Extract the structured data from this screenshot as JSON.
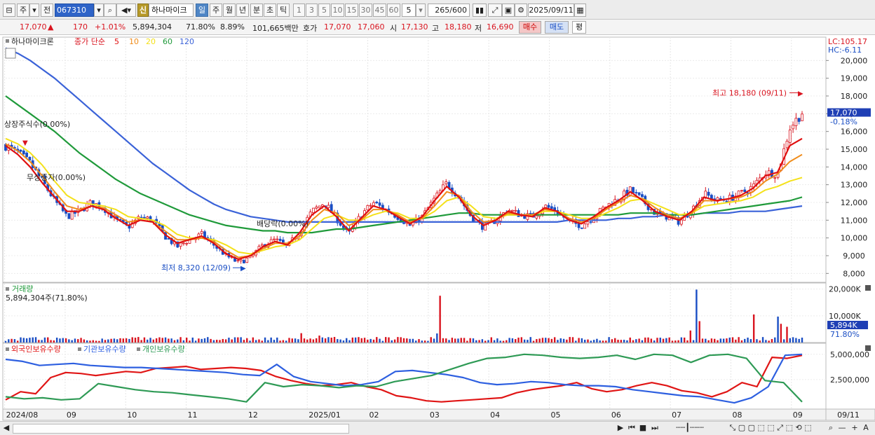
{
  "toolbar": {
    "period_main": "주",
    "compare": "전",
    "stock_code": "067310",
    "new_badge": "신",
    "stock_name": "하나마이크",
    "periods": [
      "일",
      "주",
      "월",
      "년",
      "분",
      "초",
      "틱"
    ],
    "active_period": "일",
    "intervals": [
      "1",
      "3",
      "5",
      "10",
      "15",
      "30",
      "45",
      "60"
    ],
    "interval_value": "5",
    "count": "265",
    "count_max": "/600",
    "date": "2025/09/11"
  },
  "quote": {
    "price": "17,070",
    "change": "170",
    "change_pct": "+1.01%",
    "volume": "5,894,304",
    "volume_ratio": "71.80%",
    "turnover": "8.89%",
    "amount": "101,665백만",
    "ask_label": "호가",
    "ask": "17,070",
    "bid": "17,060",
    "open_label": "시",
    "open": "17,130",
    "high_label": "고",
    "high": "18,180",
    "low_label": "저",
    "low": "16,690",
    "buy_label": "매수",
    "sell_label": "매도",
    "eval_label": "평"
  },
  "price_panel": {
    "legend_name": "하나마이크론",
    "legend_type": "종가 단순",
    "ma_labels": [
      "5",
      "10",
      "20",
      "60",
      "120"
    ],
    "lc_label": "LC:105.17",
    "hc_label": "HC:-6.11",
    "current_price_tag": "17,070",
    "current_change_tag": "-0.18%",
    "max_annotation": "최고 18,180 (09/11)",
    "min_annotation": "최저 8,320 (12/09)",
    "event_listing": "상장주식수(0.00%)",
    "event_free_issue": "무상증자(0.00%)",
    "event_dividend": "배당락(0.00%)"
  },
  "volume_panel": {
    "title": "거래량",
    "summary": "5,894,304주(71.80%)",
    "current_tag": "5,894K",
    "current_ratio_tag": "71.80%"
  },
  "holding_panel": {
    "titles": [
      "외국인보유수량",
      "기관보유수량",
      "개인보유수량"
    ]
  },
  "x_axis_labels": [
    "2024/08",
    "09",
    "10",
    "11",
    "12",
    "2025/01",
    "02",
    "03",
    "04",
    "05",
    "06",
    "07",
    "08",
    "09"
  ],
  "x_axis_last": "09/11",
  "colors": {
    "up": "#d9141f",
    "down": "#1a4ec4",
    "ma5": "#e01010",
    "ma10": "#f08c1a",
    "ma20": "#f4e11a",
    "ma60": "#1f9a3a",
    "ma120": "#3a62d8",
    "foreign": "#e01515",
    "institution": "#2d5fe0",
    "individual": "#2e9a55"
  },
  "chart_data": [
    {
      "type": "line",
      "title": "",
      "y_ticks": [
        8000,
        9000,
        10000,
        11000,
        12000,
        13000,
        14000,
        15000,
        16000,
        17000,
        18000,
        19000,
        20000
      ],
      "y_tick_labels": [
        "8,000",
        "9,000",
        "10,000",
        "11,000",
        "12,000",
        "13,000",
        "14,000",
        "15,000",
        "16,000",
        "17,000",
        "18,000",
        "19,000",
        "20,000"
      ],
      "ylim": [
        7500,
        21000
      ],
      "x_period": [
        "2024-08",
        "2025-09-11"
      ],
      "close_anchors": [
        15200,
        14800,
        14200,
        13200,
        12100,
        11200,
        11500,
        12000,
        11700,
        11000,
        10600,
        11200,
        11000,
        10100,
        9500,
        9900,
        10200,
        9600,
        9000,
        8600,
        8900,
        9600,
        9900,
        9500,
        10400,
        11500,
        12000,
        11100,
        10200,
        11300,
        12000,
        11600,
        11200,
        10700,
        11200,
        12200,
        13100,
        12300,
        11200,
        10600,
        11000,
        11600,
        11300,
        11200,
        11800,
        11500,
        10900,
        10700,
        11200,
        11800,
        12200,
        12700,
        12100,
        11400,
        11200,
        10900,
        11600,
        12500,
        12100,
        12200,
        12500,
        12900,
        13700,
        13600,
        16200,
        17070
      ],
      "series": [
        {
          "name": "5",
          "values": [
            15200,
            14700,
            14000,
            13100,
            12300,
            11500,
            11500,
            11800,
            11600,
            11100,
            10700,
            11000,
            10900,
            10200,
            9700,
            9900,
            10100,
            9700,
            9100,
            8800,
            9000,
            9500,
            9800,
            9600,
            10300,
            11300,
            11800,
            11200,
            10400,
            11100,
            11800,
            11600,
            11200,
            10800,
            11200,
            12100,
            12900,
            12300,
            11300,
            10700,
            11000,
            11500,
            11300,
            11200,
            11700,
            11500,
            11000,
            10800,
            11200,
            11700,
            12100,
            12600,
            12100,
            11500,
            11200,
            11000,
            11500,
            12300,
            12100,
            12200,
            12400,
            12800,
            13500,
            13700,
            15200,
            15600
          ]
        },
        {
          "name": "10",
          "values": [
            15300,
            14900,
            14300,
            13500,
            12600,
            11800,
            11600,
            11800,
            11700,
            11300,
            10900,
            11000,
            10900,
            10400,
            9900,
            9900,
            10000,
            9800,
            9300,
            8900,
            9000,
            9400,
            9700,
            9700,
            10100,
            11000,
            11600,
            11400,
            10700,
            11000,
            11600,
            11600,
            11300,
            10900,
            11100,
            11800,
            12600,
            12400,
            11500,
            10900,
            11000,
            11400,
            11300,
            11300,
            11600,
            11500,
            11100,
            10900,
            11100,
            11600,
            12000,
            12400,
            12200,
            11700,
            11300,
            11100,
            11400,
            12100,
            12100,
            12200,
            12300,
            12600,
            13200,
            13600,
            14300,
            14700
          ]
        },
        {
          "name": "20",
          "values": [
            15600,
            15300,
            14800,
            14100,
            13200,
            12400,
            12000,
            11900,
            11800,
            11600,
            11200,
            11100,
            11000,
            10700,
            10200,
            10000,
            10000,
            9900,
            9600,
            9200,
            9100,
            9300,
            9500,
            9600,
            9900,
            10500,
            11100,
            11300,
            11000,
            11000,
            11300,
            11500,
            11400,
            11100,
            11100,
            11500,
            12100,
            12300,
            11800,
            11200,
            11100,
            11300,
            11300,
            11300,
            11500,
            11500,
            11300,
            11100,
            11100,
            11400,
            11700,
            12100,
            12200,
            11900,
            11600,
            11300,
            11400,
            11800,
            11900,
            12000,
            12100,
            12300,
            12700,
            12900,
            13200,
            13400
          ]
        },
        {
          "name": "60",
          "values": [
            18000,
            17500,
            17000,
            16500,
            16000,
            15400,
            14800,
            14300,
            13800,
            13300,
            12900,
            12500,
            12200,
            11900,
            11600,
            11300,
            11100,
            10900,
            10700,
            10600,
            10500,
            10400,
            10400,
            10300,
            10300,
            10300,
            10400,
            10500,
            10500,
            10600,
            10700,
            10800,
            10900,
            11000,
            11100,
            11200,
            11300,
            11400,
            11400,
            11300,
            11300,
            11300,
            11300,
            11300,
            11300,
            11300,
            11300,
            11300,
            11300,
            11300,
            11300,
            11400,
            11400,
            11400,
            11300,
            11300,
            11300,
            11400,
            11500,
            11600,
            11700,
            11800,
            11900,
            12000,
            12100,
            12300
          ]
        },
        {
          "name": "120",
          "values": [
            20700,
            20400,
            20000,
            19500,
            19000,
            18400,
            17800,
            17200,
            16600,
            16000,
            15400,
            14800,
            14200,
            13700,
            13200,
            12700,
            12300,
            11900,
            11600,
            11400,
            11200,
            11100,
            11000,
            10900,
            10900,
            10900,
            10900,
            10900,
            10900,
            10900,
            10900,
            10900,
            10900,
            10900,
            10900,
            10900,
            10900,
            10900,
            10900,
            10900,
            10900,
            10900,
            10900,
            10900,
            10900,
            10900,
            11000,
            11000,
            11000,
            11000,
            11100,
            11100,
            11200,
            11200,
            11300,
            11300,
            11300,
            11400,
            11400,
            11400,
            11500,
            11500,
            11500,
            11600,
            11700,
            11800
          ]
        }
      ]
    },
    {
      "type": "bar",
      "title": "거래량",
      "y_tick_labels": [
        "10,000K",
        "20,000K"
      ],
      "y_ticks": [
        10000,
        20000
      ],
      "ylim": [
        0,
        22000
      ],
      "unit": "K",
      "spikes": [
        {
          "position": 0.145,
          "value": 1600
        },
        {
          "position": 0.37,
          "value": 3500
        },
        {
          "position": 0.395,
          "value": 2600
        },
        {
          "position": 0.54,
          "value": 3400
        },
        {
          "position": 0.545,
          "value": 17500
        },
        {
          "position": 0.86,
          "value": 4500
        },
        {
          "position": 0.866,
          "value": 19800
        },
        {
          "position": 0.872,
          "value": 8000
        },
        {
          "position": 0.938,
          "value": 10500
        },
        {
          "position": 0.968,
          "value": 9700
        },
        {
          "position": 0.974,
          "value": 7000
        },
        {
          "position": 0.98,
          "value": 5894
        }
      ]
    },
    {
      "type": "line",
      "title": "외국인보유수량 / 기관보유수량 / 개인보유수량",
      "y_ticks": [
        2500000,
        5000000
      ],
      "y_tick_labels": [
        "2,500,000",
        "5,000,000"
      ],
      "ylim": [
        0,
        5400000
      ],
      "series": [
        {
          "name": "외국인보유수량",
          "values": [
            500000,
            1300000,
            1100000,
            2700000,
            3200000,
            3100000,
            2900000,
            3100000,
            3300000,
            3200000,
            3600000,
            3700000,
            3800000,
            3500000,
            3600000,
            3700000,
            3600000,
            3400000,
            2800000,
            2400000,
            2100000,
            1900000,
            2000000,
            2200000,
            1800000,
            1500000,
            900000,
            700000,
            400000,
            300000,
            400000,
            500000,
            600000,
            700000,
            1200000,
            1500000,
            1700000,
            1900000,
            2200000,
            1600000,
            1300000,
            1500000,
            1900000,
            2200000,
            1900000,
            1400000,
            1200000,
            800000,
            1300000,
            2200000,
            1800000,
            4700000,
            4600000,
            4900000
          ]
        },
        {
          "name": "기관보유수량",
          "values": [
            4500000,
            4300000,
            3900000,
            4000000,
            4100000,
            3900000,
            3800000,
            3700000,
            3700000,
            3600000,
            3500000,
            3400000,
            3300000,
            3200000,
            3000000,
            2900000,
            4000000,
            2800000,
            2300000,
            2100000,
            1900000,
            2000000,
            2300000,
            3300000,
            3400000,
            3200000,
            3000000,
            2700000,
            2200000,
            2000000,
            2100000,
            2300000,
            2200000,
            2000000,
            1900000,
            1900000,
            1800000,
            1500000,
            1300000,
            1100000,
            900000,
            800000,
            500000,
            200000,
            700000,
            1800000,
            4900000,
            5000000
          ]
        },
        {
          "name": "개인보유수량",
          "values": [
            800000,
            600000,
            700000,
            500000,
            600000,
            2100000,
            1800000,
            1500000,
            1300000,
            1200000,
            1000000,
            800000,
            600000,
            300000,
            2200000,
            1800000,
            2000000,
            1900000,
            1700000,
            1900000,
            1800000,
            2300000,
            2600000,
            2900000,
            3500000,
            4100000,
            4600000,
            4700000,
            5000000,
            4900000,
            4700000,
            4600000,
            4700000,
            4900000,
            4500000,
            5000000,
            4900000,
            4200000,
            4900000,
            5000000,
            4600000,
            2400000,
            2200000,
            300000
          ]
        }
      ]
    }
  ]
}
